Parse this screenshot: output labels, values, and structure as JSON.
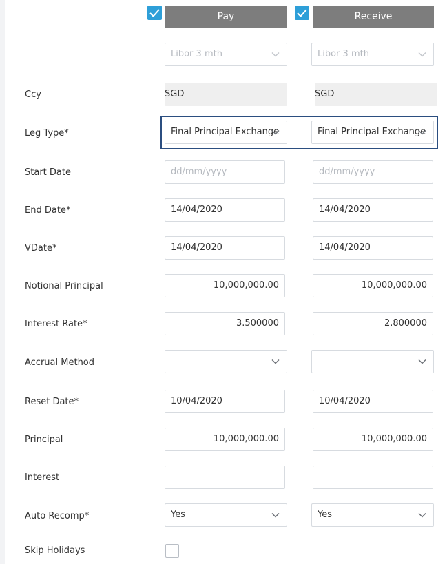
{
  "header": {
    "pay": {
      "label": "Pay",
      "checked": true
    },
    "receive": {
      "label": "Receive",
      "checked": true
    }
  },
  "index": {
    "pay_placeholder": "Libor 3 mth",
    "receive_placeholder": "Libor 3 mth"
  },
  "fields": {
    "ccy": {
      "label": "Ccy",
      "pay": "SGD",
      "receive": "SGD"
    },
    "leg_type": {
      "label": "Leg Type*",
      "pay": "Final Principal Exchange",
      "receive": "Final Principal Exchange"
    },
    "start_date": {
      "label": "Start Date",
      "pay_placeholder": "dd/mm/yyyy",
      "receive_placeholder": "dd/mm/yyyy"
    },
    "end_date": {
      "label": "End Date*",
      "pay": "14/04/2020",
      "receive": "14/04/2020"
    },
    "vdate": {
      "label": "VDate*",
      "pay": "14/04/2020",
      "receive": "14/04/2020"
    },
    "notional_principal": {
      "label": "Notional Principal",
      "pay": "10,000,000.00",
      "receive": "10,000,000.00"
    },
    "interest_rate": {
      "label": "Interest Rate*",
      "pay": "3.500000",
      "receive": "2.800000"
    },
    "accrual_method": {
      "label": "Accrual Method",
      "pay": "",
      "receive": ""
    },
    "reset_date": {
      "label": "Reset Date*",
      "pay": "10/04/2020",
      "receive": "10/04/2020"
    },
    "principal": {
      "label": "Principal",
      "pay": "10,000,000.00",
      "receive": "10,000,000.00"
    },
    "interest": {
      "label": "Interest",
      "pay": "",
      "receive": ""
    },
    "auto_recomp": {
      "label": "Auto Recomp*",
      "pay": "Yes",
      "receive": "Yes"
    },
    "skip_holidays": {
      "label": "Skip Holidays",
      "checked": false
    }
  },
  "colors": {
    "header_button": "#7d7d7d",
    "checkbox": "#2e9fd8",
    "focus_border": "#2b4e80",
    "readonly_bg": "#efefef"
  },
  "icons": {
    "checkbox_check": "check-icon",
    "dropdown": "chevron-down-icon"
  }
}
